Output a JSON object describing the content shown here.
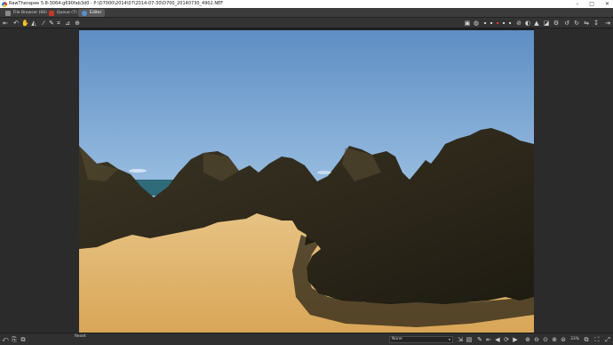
{
  "window": {
    "title": "RawTherapee 5.8-3064-g690fab3d0 - P:\\D7000\\2014\\07\\2014-07-30\\D700_20140730_4902.NEF",
    "controls": [
      "minimize-icon",
      "maximize-icon",
      "close-icon"
    ]
  },
  "tabs": [
    {
      "label": "File Browser (66)",
      "icon": "folder-icon"
    },
    {
      "label": "Queue (7)",
      "icon": "queue-icon"
    },
    {
      "label": "Editor",
      "icon": "editor-icon"
    }
  ],
  "toolbar": {
    "left_icons": [
      "sidebar-toggle-icon",
      "undo-history-icon",
      "hand-icon",
      "wb-picker-icon",
      "color-picker-icon",
      "crop-icon",
      "straighten-icon",
      "target-icon"
    ],
    "right_icons": [
      "preview-modes-icon",
      "focus-mask-icon",
      "warning-icon",
      "shadow-clip-icon",
      "highlight-clip-icon",
      "before-after-icon",
      "rotate-left-icon",
      "rotate-right-icon",
      "flip-icon",
      "panel-toggle-icon"
    ]
  },
  "statusbar": {
    "reset_label": "Reset",
    "profile_select": "None",
    "zoom": "33%"
  },
  "photo": {
    "description_colors": {
      "sky_top": "#5a8ac0",
      "sky_bottom": "#b9d6ee",
      "sand": "#e0b46a",
      "rock": "#2a2619"
    }
  }
}
